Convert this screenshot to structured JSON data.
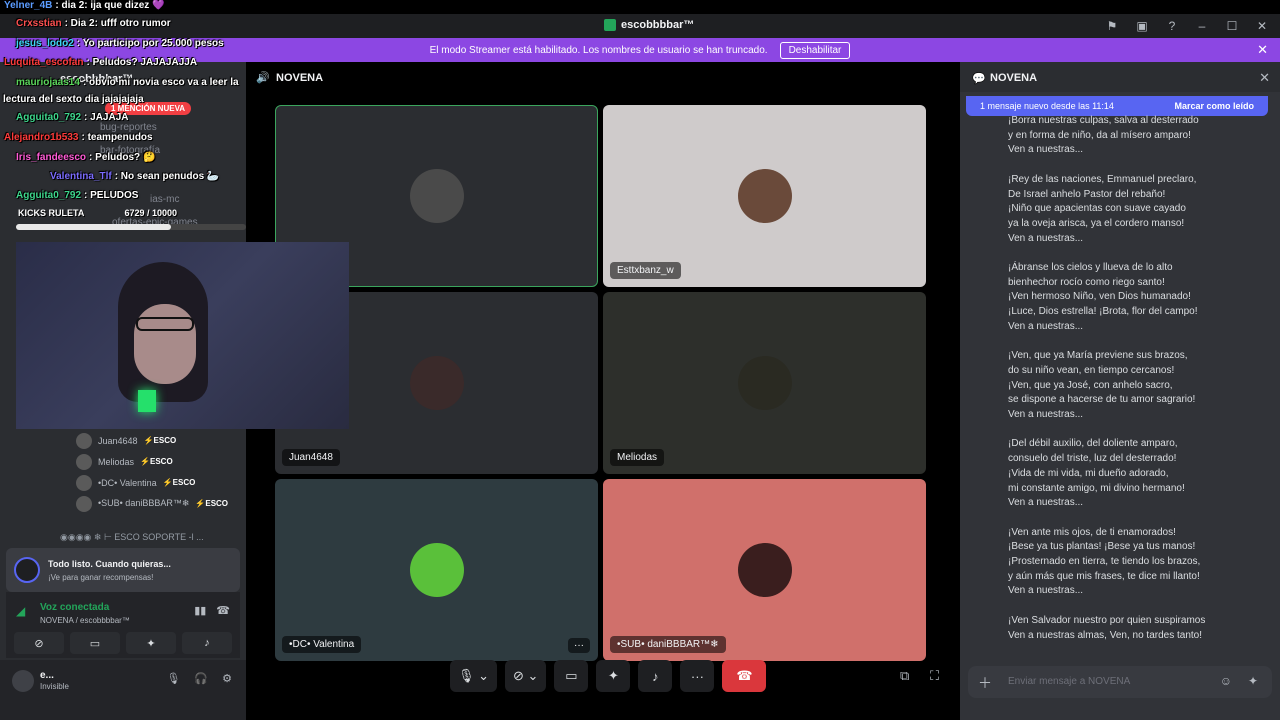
{
  "app": {
    "title": "escobbbbar™"
  },
  "overlay_chat": [
    {
      "nick": "Yelner_4B",
      "color": "#5b9cff",
      "text": ": dia 2: ija que dizez 💜"
    },
    {
      "nick": "Crxsstian",
      "color": "#ff5050",
      "text": ": Dia 2: ufff otro rumor"
    },
    {
      "nick": "jesus_lodo2",
      "color": "#3dd6f5",
      "text": ": Yo participo por 25.000 pesos"
    },
    {
      "nick": "Luquita_escofan",
      "color": "#ff3b3b",
      "text": ": Peludos? JAJAJAJJA"
    },
    {
      "nick": "mauriojaas14",
      "color": "#5bd65b",
      "text": ": obvio mi novia esco va a leer la"
    },
    {
      "nick": "",
      "color": "#ffffff",
      "text": "lectura del sexto dia jajajajaja"
    },
    {
      "nick": "Agguita0_792",
      "color": "#3dd68c",
      "text": ": JAJAJA"
    },
    {
      "nick": "Alejandro1b533",
      "color": "#ff3b3b",
      "text": ": teampenudos"
    },
    {
      "nick": "Iris_fandeesco",
      "color": "#ff5bd6",
      "text": ": Peludos? 🤔"
    },
    {
      "nick": "Valentina_Tlf",
      "color": "#7b6cff",
      "text": ": No sean penudos 🦢"
    },
    {
      "nick": "Agguita0_792",
      "color": "#3dd68c",
      "text": ": PELUDOS"
    }
  ],
  "kicks": {
    "label": "KICKS RULETA",
    "count": "6729  / 10000",
    "progress": 0.6729
  },
  "sidebar": {
    "server_name": "escobbbbar™ ⌄",
    "mention_badge": "1 MENCIÓN NUEVA",
    "channels": [
      "bug-reportes",
      "bar-fotografía",
      "ias-mc",
      "ofertas-epic-games"
    ],
    "voice_users": [
      {
        "name": "Juan4648",
        "tag": "ESCO"
      },
      {
        "name": "Meliodas",
        "tag": "ESCO"
      },
      {
        "name": "•DC• Valentina",
        "tag": "ESCO"
      },
      {
        "name": "•SUB• daniBBBAR™❄",
        "tag": "ESCO"
      }
    ],
    "soporte": "◉◉◉◉ ❄ ⊢ ESCO SOPORTE -l ...",
    "ready_title": "Todo listo. Cuando quieras...",
    "ready_sub": "¡Ve para ganar recompensas!",
    "voice_status": "Voz conectada",
    "voice_channel": "NOVENA / escobbbbar™",
    "user_name": "e...",
    "user_status": "Invisible"
  },
  "banner": {
    "text": "El modo Streamer está habilitado. Los nombres de usuario se han truncado.",
    "button": "Deshabilitar"
  },
  "main": {
    "channel": "NOVENA",
    "tiles": [
      {
        "name": "",
        "bg": "#2b2d31",
        "avatar_color": "#4a4a4a",
        "border": "#3ba55d"
      },
      {
        "name": "Esttxbanz_w",
        "bg": "#cfcbcb",
        "avatar_color": "#6a4a3a",
        "border": ""
      },
      {
        "name": "Juan4648",
        "bg": "#2b2d31",
        "avatar_color": "#3a2a2a",
        "border": ""
      },
      {
        "name": "Meliodas",
        "bg": "#2d2f2b",
        "avatar_color": "#2a2a22",
        "border": ""
      },
      {
        "name": "•DC• Valentina",
        "bg": "#2e3b40",
        "avatar_color": "#5ac03a",
        "border": ""
      },
      {
        "name": "•SUB• daniBBBAR™❄",
        "bg": "#d0706b",
        "avatar_color": "#3a1e1e",
        "border": ""
      }
    ],
    "more_label": "···"
  },
  "chat": {
    "title": "NOVENA",
    "new_msgs": "1 mensaje nuevo desde las 11:14",
    "mark_read": "Marcar como leído",
    "stanzas": [
      [
        "¡Borra nuestras culpas, salva al desterrado",
        "y en forma de niño, da al mísero amparo!",
        "Ven a nuestras..."
      ],
      [
        "¡Rey de las naciones, Emmanuel preclaro,",
        "De Israel anhelo Pastor del rebaño!",
        "¡Niño que apacientas con suave cayado",
        "ya la oveja arisca, ya el cordero manso!",
        "Ven a nuestras..."
      ],
      [
        "¡Ábranse los cielos y llueva de lo alto",
        "bienhechor rocío como riego santo!",
        "¡Ven hermoso Niño, ven Dios humanado!",
        "¡Luce, Dios estrella! ¡Brota, flor del campo!",
        "Ven a nuestras..."
      ],
      [
        "¡Ven, que ya María previene sus brazos,",
        "do su niño vean, en tiempo cercanos!",
        "¡Ven, que ya José, con anhelo sacro,",
        "se dispone a hacerse de tu amor sagrario!",
        "Ven a nuestras..."
      ],
      [
        "¡Del débil auxilio, del doliente amparo,",
        "consuelo del triste, luz del desterrado!",
        "¡Vida de mi vida, mi dueño adorado,",
        "mi constante amigo, mi divino hermano!",
        "Ven a nuestras..."
      ],
      [
        "¡Ven ante mis ojos, de ti enamorados!",
        "¡Bese ya tus plantas! ¡Bese ya tus manos!",
        "¡Prosternado en tierra, te tiendo los brazos,",
        "y aún más que mis frases, te dice mi llanto!",
        "Ven a nuestras..."
      ],
      [
        "¡Ven Salvador nuestro por quien suspiramos",
        "Ven a nuestras almas, Ven, no tardes tanto!"
      ]
    ],
    "input_placeholder": "Enviar mensaje a NOVENA"
  }
}
